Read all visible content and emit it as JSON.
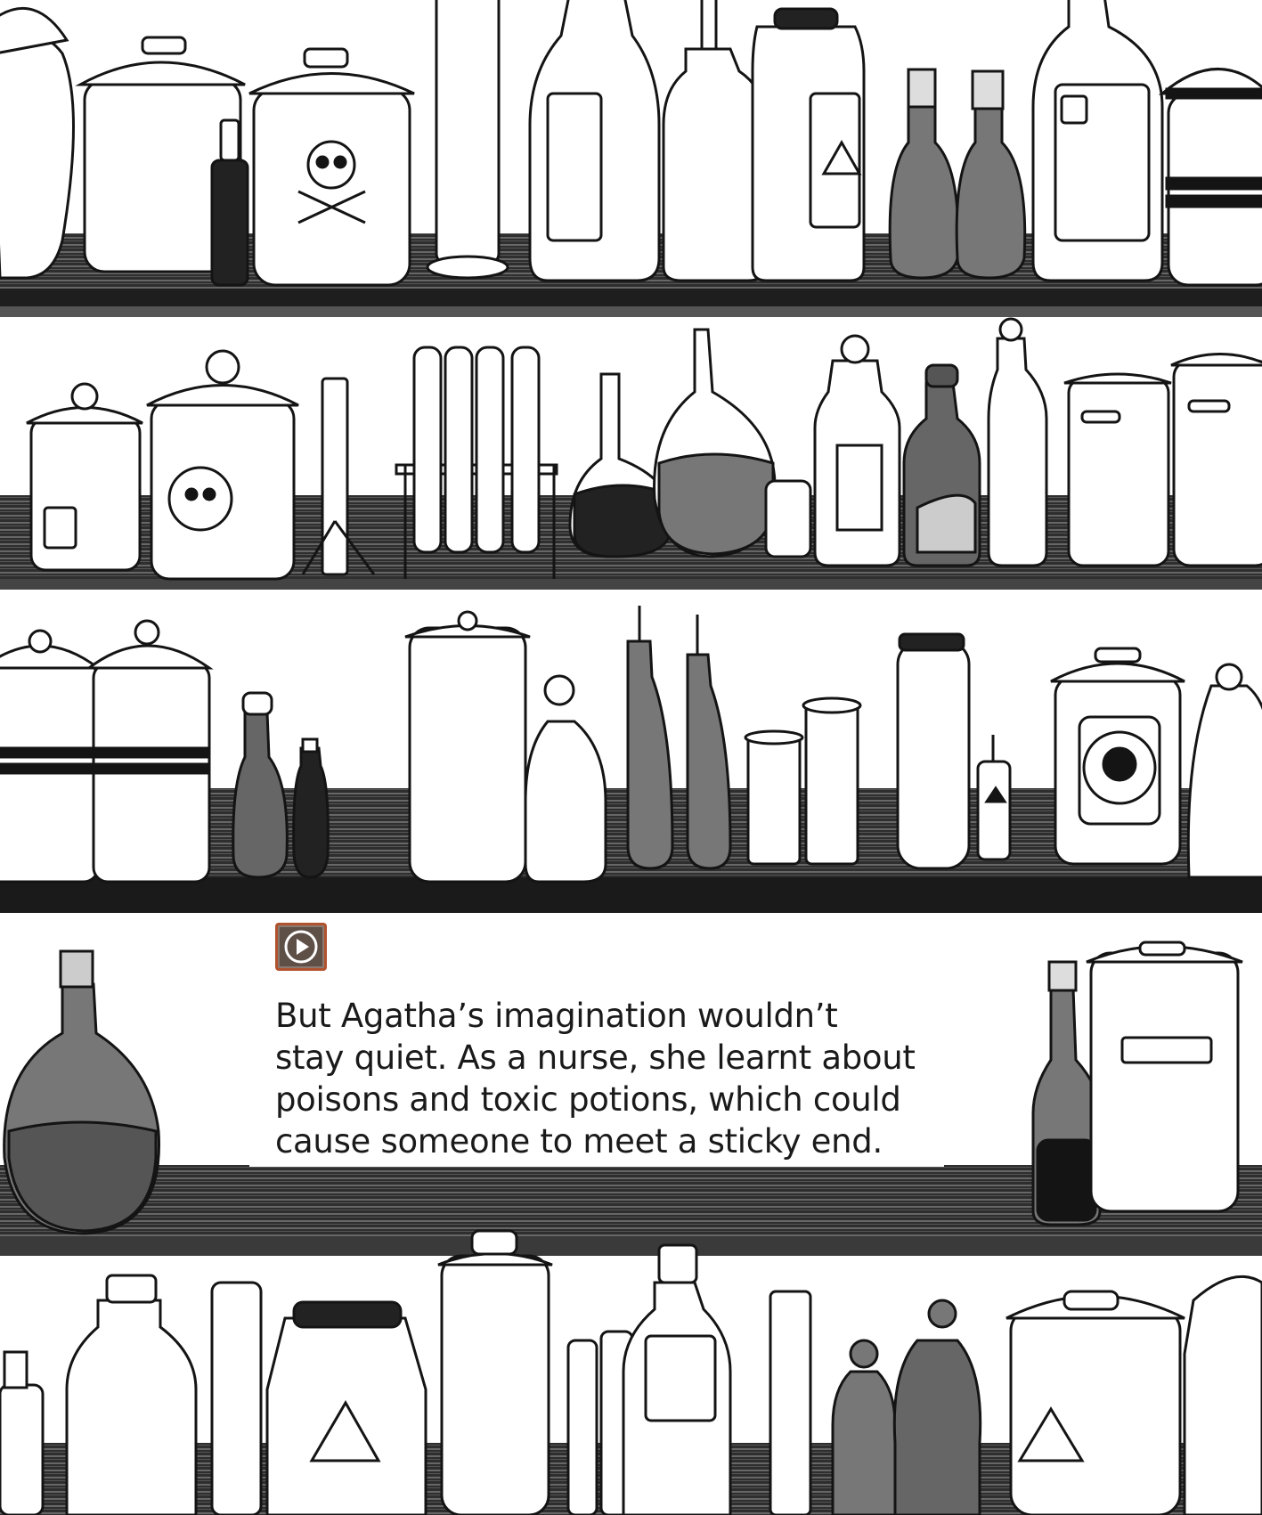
{
  "illustration": {
    "description_name": "apothecary-shelves",
    "colors": {
      "ink": "#141414",
      "shelf_dark": "#3a3a3a",
      "shelf_light": "#7a7a7a",
      "liquid_grey": "#6f6f6f",
      "liquid_dark": "#222222",
      "paper": "#ffffff"
    }
  },
  "audio": {
    "play_icon": "play-icon",
    "button_color": "#5e4f47",
    "border_color": "#b0522d"
  },
  "story": {
    "lines": [
      "But Agatha’s imagination wouldn’t",
      "stay quiet. As a nurse, she learnt about",
      "poisons and toxic potions, which could",
      "cause someone to meet a sticky end."
    ]
  }
}
